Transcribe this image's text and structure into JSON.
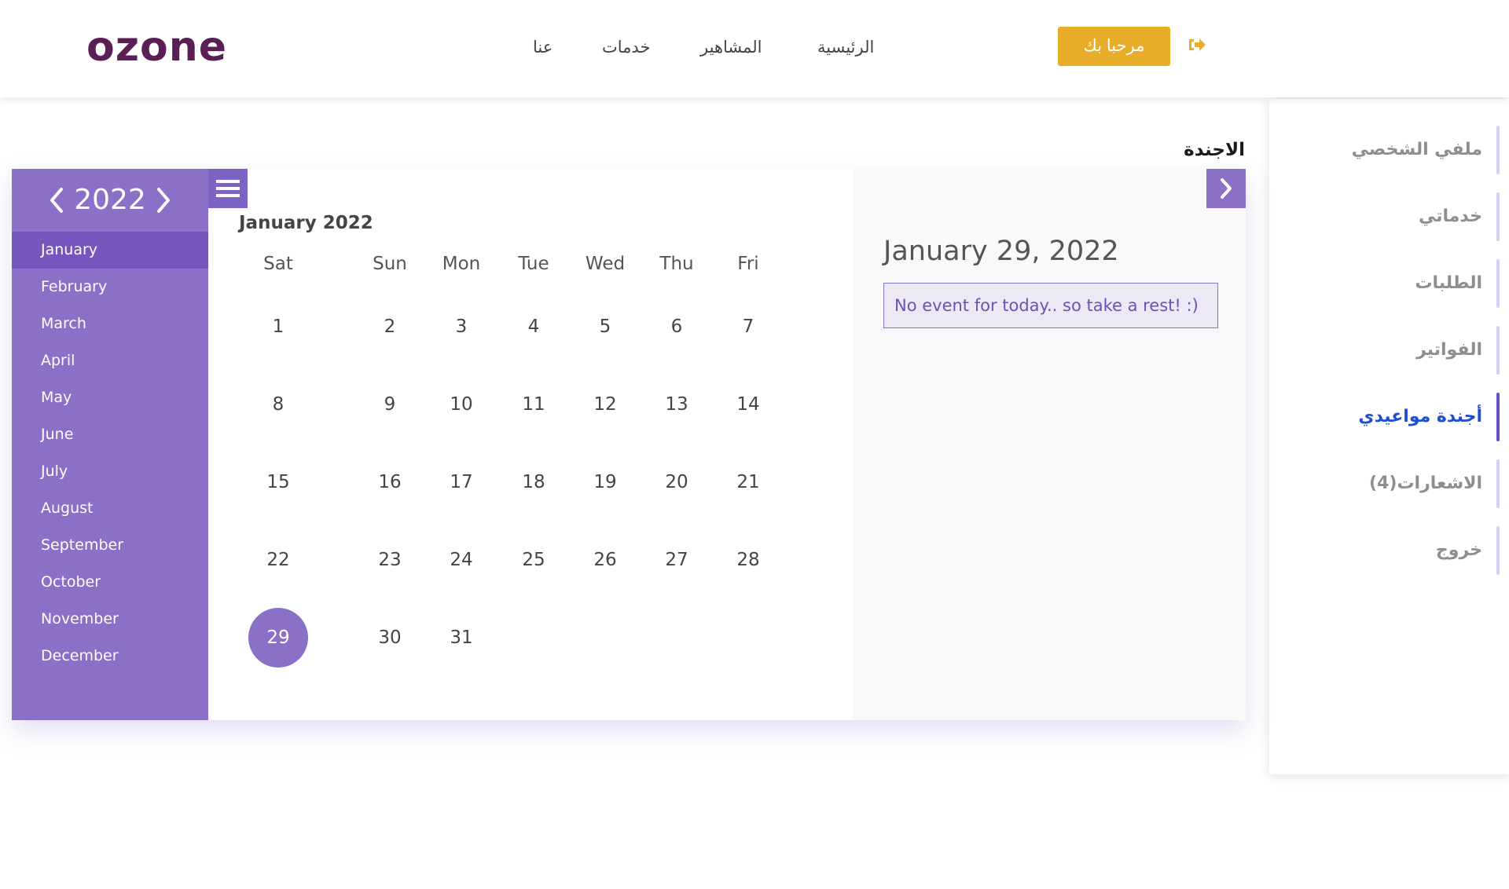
{
  "header": {
    "logo_text": "ozone",
    "nav": {
      "about": "عنا",
      "services": "خدمات",
      "celebrities": "المشاهير",
      "home": "الرئيسية"
    },
    "welcome_button": "مرحبا بك",
    "signout_icon": "sign-out-icon"
  },
  "sidebar": {
    "items": [
      {
        "label": "ملفي الشخصي",
        "active": false
      },
      {
        "label": "خدماتي",
        "active": false
      },
      {
        "label": "الطلبات",
        "active": false
      },
      {
        "label": "الفواتير",
        "active": false
      },
      {
        "label": "أجندة مواعيدي",
        "active": true
      },
      {
        "label": "الاشعارات(4)",
        "active": false
      },
      {
        "label": "خروج",
        "active": false
      }
    ]
  },
  "page_title": "الاجندة",
  "calendar": {
    "year": "2022",
    "months": [
      "January",
      "February",
      "March",
      "April",
      "May",
      "June",
      "July",
      "August",
      "September",
      "October",
      "November",
      "December"
    ],
    "active_month_index": 0,
    "month_title": "January 2022",
    "weekdays": [
      "Sat",
      "Sun",
      "Mon",
      "Tue",
      "Wed",
      "Thu",
      "Fri"
    ],
    "weeks": [
      [
        "1",
        "2",
        "3",
        "4",
        "5",
        "6",
        "7"
      ],
      [
        "8",
        "9",
        "10",
        "11",
        "12",
        "13",
        "14"
      ],
      [
        "15",
        "16",
        "17",
        "18",
        "19",
        "20",
        "21"
      ],
      [
        "22",
        "23",
        "24",
        "25",
        "26",
        "27",
        "28"
      ],
      [
        "29",
        "30",
        "31",
        "",
        "",
        "",
        ""
      ]
    ],
    "selected_day": "29",
    "selected_date_label": "January 29, 2022",
    "event_message": "No event for today.. so take a rest! :)"
  },
  "colors": {
    "accent": "#8a70c7",
    "accent_dark": "#7556bd",
    "welcome_button": "#e8ad2b",
    "logo": "#5a1f55",
    "active_sidebar_text": "#1e4fd0"
  }
}
